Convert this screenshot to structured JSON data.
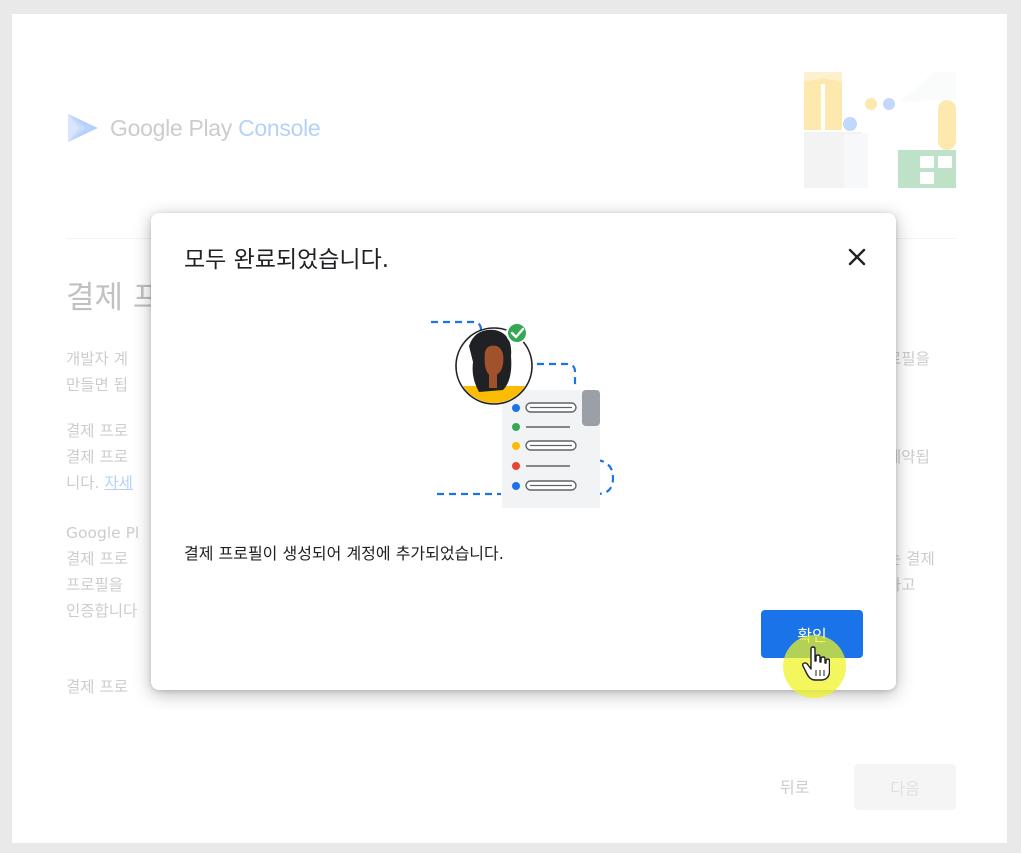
{
  "header": {
    "logo_google_play": "Google Play ",
    "logo_console": "Console"
  },
  "background": {
    "page_title": "결제 프",
    "para1_line1_left": "개발자 계",
    "para1_line1_right": "로필을",
    "para1_line2_left": "만들면 됩",
    "para2_line1_left": "결제 프로",
    "para2_line2_left": "결제 프로",
    "para2_line2_right": "예약됩",
    "para2_line3_left": "니다. ",
    "para2_link": "자세",
    "para3_line1_left": "Google Pl",
    "para3_line2_left": "결제 프로",
    "para3_line2_right": "는 결제",
    "para3_line3_left": "프로필을 ",
    "para3_line3_right": "하고",
    "para3_line4_left": "인증합니다",
    "para4_line1_left": "결제 프로"
  },
  "footer": {
    "back_label": "뒤로",
    "next_label": "다음"
  },
  "dialog": {
    "title": "모두 완료되었습니다.",
    "message": "결제 프로필이 생성되어 계정에 추가되었습니다.",
    "ok_label": "확인"
  },
  "colors": {
    "accent": "#1a73e8",
    "success": "#34a853",
    "cursor_highlight": "#eef41e"
  },
  "icons": {
    "close": "close-icon",
    "logo": "play-console-logo",
    "cursor": "hand-pointer-icon"
  }
}
